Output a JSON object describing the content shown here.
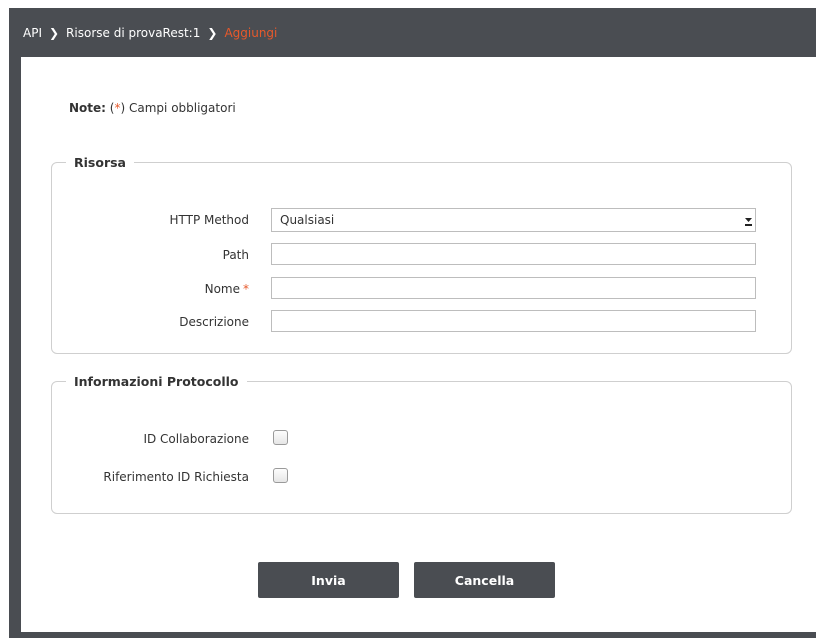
{
  "breadcrumb": {
    "items": [
      "API",
      "Risorse di provaRest:1",
      "Aggiungi"
    ],
    "current_color": "#e7592b"
  },
  "note": {
    "label": "Note:",
    "required_marker": "(*)",
    "text": "Campi obbligatori"
  },
  "risorsa": {
    "legend": "Risorsa",
    "http_method_label": "HTTP Method",
    "http_method_value": "Qualsiasi",
    "path_label": "Path",
    "path_value": "",
    "nome_label": "Nome",
    "nome_required": "*",
    "nome_value": "",
    "descrizione_label": "Descrizione",
    "descrizione_value": ""
  },
  "protocollo": {
    "legend": "Informazioni Protocollo",
    "id_collaborazione_label": "ID Collaborazione",
    "id_collaborazione_checked": false,
    "riferimento_label": "Riferimento ID Richiesta",
    "riferimento_checked": false
  },
  "actions": {
    "submit_label": "Invia",
    "cancel_label": "Cancella"
  },
  "colors": {
    "header_bg": "#4a4d52",
    "accent": "#e7592b"
  }
}
